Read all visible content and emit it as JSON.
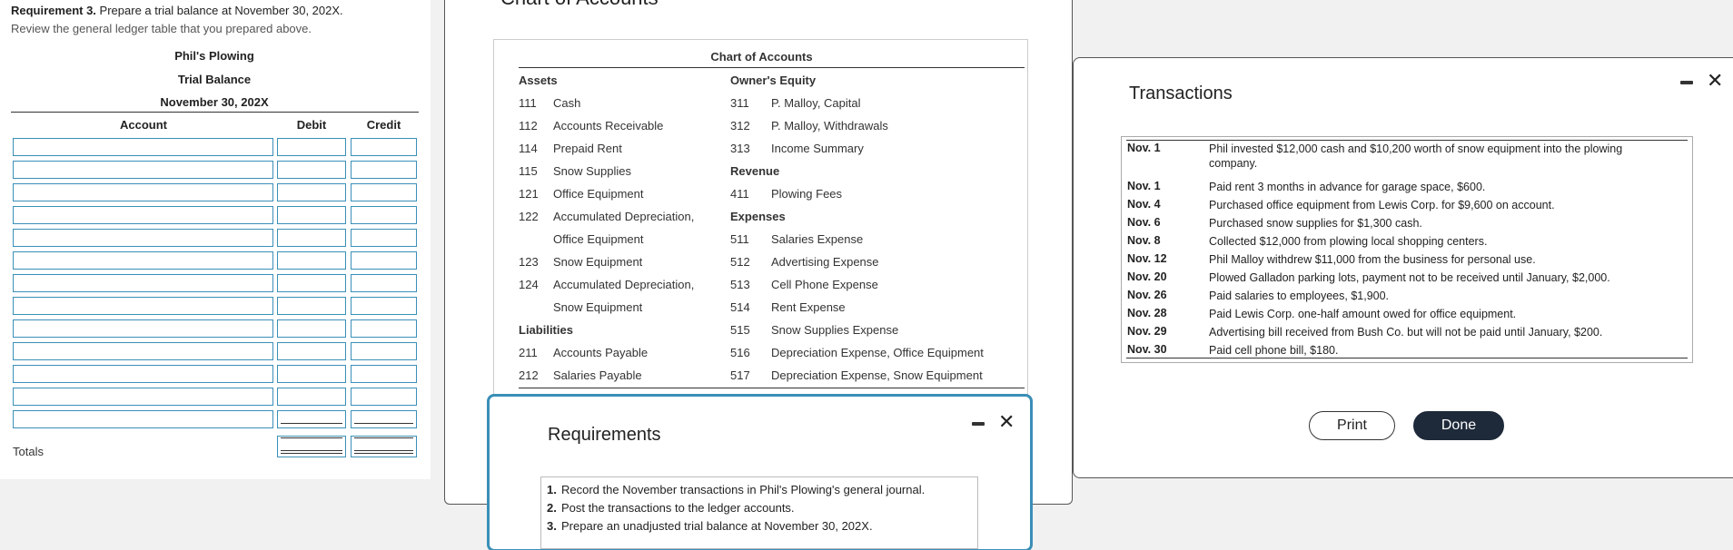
{
  "left": {
    "req_label": "Requirement 3.",
    "req_text": "Prepare a trial balance at November 30, 202X.",
    "review": "Review the general ledger table that you prepared above.",
    "company": "Phil's Plowing",
    "statement": "Trial Balance",
    "date": "November 30, 202X",
    "col_account": "Account",
    "col_debit": "Debit",
    "col_credit": "Credit",
    "totals": "Totals"
  },
  "coa": {
    "window_title": "Chart of Accounts",
    "box_title": "Chart of Accounts",
    "assets_h": "Assets",
    "owners_h": "Owner's Equity",
    "revenue_h": "Revenue",
    "expenses_h": "Expenses",
    "liabilities_h": "Liabilities",
    "assets": [
      {
        "num": "111",
        "name": "Cash"
      },
      {
        "num": "112",
        "name": "Accounts Receivable"
      },
      {
        "num": "114",
        "name": "Prepaid Rent"
      },
      {
        "num": "115",
        "name": "Snow Supplies"
      },
      {
        "num": "121",
        "name": "Office Equipment"
      },
      {
        "num": "122",
        "name": "Accumulated Depreciation,"
      },
      {
        "num": "",
        "name": "Office Equipment"
      },
      {
        "num": "123",
        "name": "Snow Equipment"
      },
      {
        "num": "124",
        "name": "Accumulated Depreciation,"
      },
      {
        "num": "",
        "name": "Snow Equipment"
      }
    ],
    "liabilities": [
      {
        "num": "211",
        "name": "Accounts Payable"
      },
      {
        "num": "212",
        "name": "Salaries Payable"
      }
    ],
    "owners": [
      {
        "num": "311",
        "name": "P. Malloy, Capital"
      },
      {
        "num": "312",
        "name": "P. Malloy, Withdrawals"
      },
      {
        "num": "313",
        "name": "Income Summary"
      }
    ],
    "revenue": [
      {
        "num": "411",
        "name": "Plowing Fees"
      }
    ],
    "expenses": [
      {
        "num": "511",
        "name": "Salaries Expense"
      },
      {
        "num": "512",
        "name": "Advertising Expense"
      },
      {
        "num": "513",
        "name": "Cell Phone Expense"
      },
      {
        "num": "514",
        "name": "Rent Expense"
      },
      {
        "num": "515",
        "name": "Snow Supplies Expense"
      },
      {
        "num": "516",
        "name": "Depreciation Expense, Office Equipment"
      },
      {
        "num": "517",
        "name": "Depreciation Expense, Snow Equipment"
      }
    ]
  },
  "requirements": {
    "title": "Requirements",
    "items": [
      {
        "n": "1.",
        "text": "Record the November transactions in Phil's Plowing's general journal."
      },
      {
        "n": "2.",
        "text": "Post the transactions to the ledger accounts."
      },
      {
        "n": "3.",
        "text": "Prepare an unadjusted trial balance at November 30, 202X."
      }
    ]
  },
  "transactions": {
    "title": "Transactions",
    "rows": [
      {
        "date": "Nov. 1",
        "text": "Phil invested $12,000 cash and $10,200 worth of snow equipment into the plowing company."
      },
      {
        "date": "Nov. 1",
        "text": "Paid rent 3 months in advance for garage space, $600."
      },
      {
        "date": "Nov. 4",
        "text": "Purchased office equipment from Lewis Corp. for $9,600 on account."
      },
      {
        "date": "Nov. 6",
        "text": "Purchased snow supplies for $1,300 cash."
      },
      {
        "date": "Nov. 8",
        "text": "Collected $12,000 from plowing local shopping centers."
      },
      {
        "date": "Nov. 12",
        "text": "Phil Malloy withdrew $11,000 from the business for personal use."
      },
      {
        "date": "Nov. 20",
        "text": "Plowed Galladon parking lots, payment not to be received until January, $2,000."
      },
      {
        "date": "Nov. 26",
        "text": "Paid salaries to employees, $1,900."
      },
      {
        "date": "Nov. 28",
        "text": "Paid Lewis Corp. one-half amount owed for office equipment."
      },
      {
        "date": "Nov. 29",
        "text": "Advertising bill received from Bush Co. but will not be paid until January, $200."
      },
      {
        "date": "Nov. 30",
        "text": "Paid cell phone bill, $180."
      }
    ],
    "print_label": "Print",
    "done_label": "Done"
  },
  "icons": {
    "minimize": "minimize-icon",
    "close": "close-icon"
  },
  "colors": {
    "input_border": "#3a8fb7",
    "done_button": "#1e2a3a"
  }
}
